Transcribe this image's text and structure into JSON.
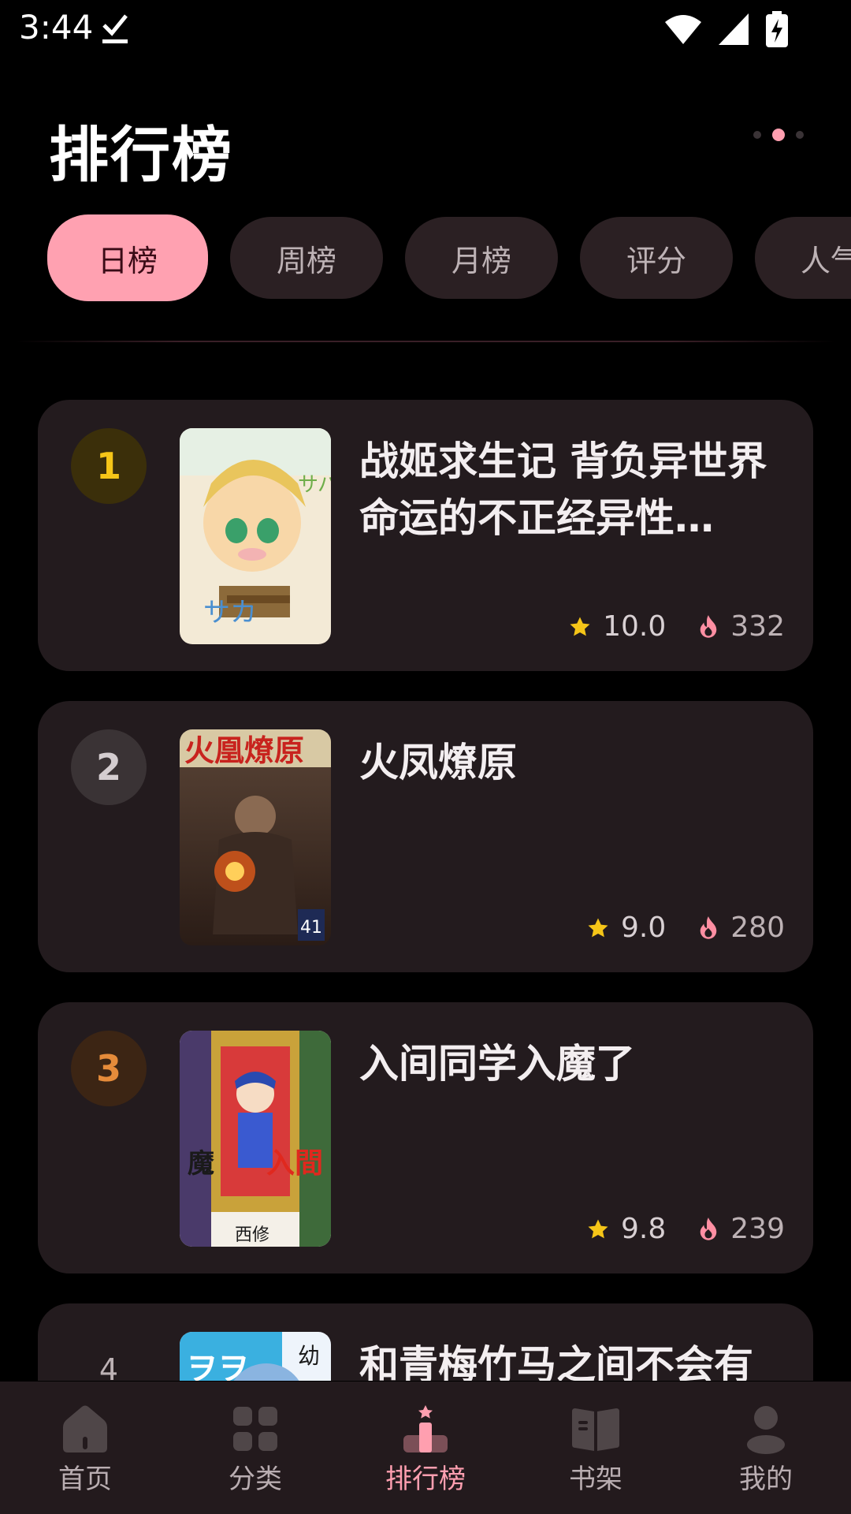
{
  "status_bar": {
    "time": "3:44"
  },
  "header": {
    "title": "排行榜"
  },
  "tabs": [
    {
      "label": "日榜",
      "active": true
    },
    {
      "label": "周榜",
      "active": false
    },
    {
      "label": "月榜",
      "active": false
    },
    {
      "label": "评分",
      "active": false
    },
    {
      "label": "人气",
      "active": false
    }
  ],
  "rankings": [
    {
      "rank": "1",
      "title": "战姬求生记 背负异世界命运的不正经异性…",
      "rating": "10.0",
      "hot": "332"
    },
    {
      "rank": "2",
      "title": "火凤燎原",
      "rating": "9.0",
      "hot": "280"
    },
    {
      "rank": "3",
      "title": "入间同学入魔了",
      "rating": "9.8",
      "hot": "239"
    },
    {
      "rank": "4",
      "title": "和青梅竹马之间不会有",
      "rating": "",
      "hot": ""
    }
  ],
  "bottom_nav": [
    {
      "label": "首页",
      "icon": "home-icon",
      "active": false
    },
    {
      "label": "分类",
      "icon": "category-icon",
      "active": false
    },
    {
      "label": "排行榜",
      "icon": "ranking-icon",
      "active": true
    },
    {
      "label": "书架",
      "icon": "bookshelf-icon",
      "active": false
    },
    {
      "label": "我的",
      "icon": "profile-icon",
      "active": false
    }
  ],
  "colors": {
    "accent": "#ffa1b1",
    "gold": "#f5c518",
    "card_bg": "#231b1e",
    "background": "#000000"
  }
}
